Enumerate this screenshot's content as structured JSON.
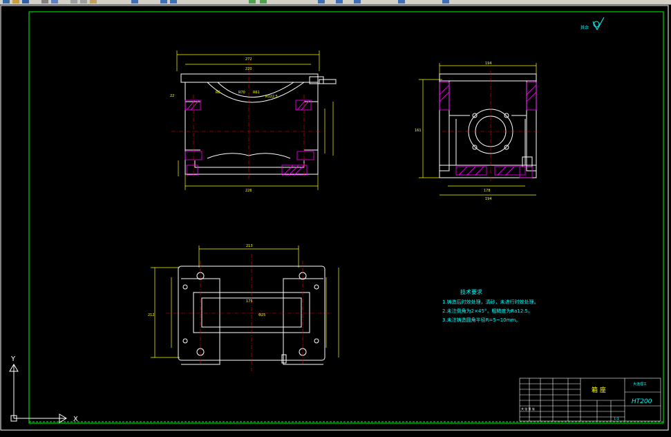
{
  "toolbar": {
    "icons": [
      "new-icon",
      "open-icon",
      "save-icon",
      "print-icon",
      "preview-icon",
      "cut-icon",
      "copy-icon",
      "paste-icon",
      "match-icon",
      "undo-icon",
      "redo-icon",
      "pan-icon",
      "zoom-icon",
      "properties-icon",
      "designcenter-icon",
      "toolpalette-icon",
      "layer-icon",
      "help-icon"
    ],
    "bg": "#d4d0c8"
  },
  "drawing": {
    "roughness_label": "其余",
    "tech_title": "技术要求",
    "tech_items": [
      "1.铸造后时效处理，清砂，未进行时效处理。",
      "2.未注倒角为2×45°，粗糙度为Ra12.5。",
      "3.未注铸造圆角半径R=5~10mm。"
    ],
    "dims_top": [
      "272",
      "220",
      "22",
      "226",
      "R6",
      "R70",
      "R61",
      "R122.5"
    ],
    "dims_side": [
      "194",
      "178",
      "194",
      "161"
    ],
    "dims_plan": [
      "213",
      "175",
      "212",
      "Φ25"
    ],
    "title_block": {
      "part_name": "箱 座",
      "material": "HT200",
      "company": "大连理工",
      "scale": "1:1",
      "sheet": "共 张 第 张"
    },
    "ucs": {
      "y": "Y",
      "x": "X"
    },
    "colors": {
      "background": "#000000",
      "geometry": "#ffffff",
      "dimension": "#ffff00",
      "hatch": "#ff00ff",
      "centerline": "#ff0000",
      "text": "#00ffff",
      "frame": "#00ff00"
    }
  }
}
